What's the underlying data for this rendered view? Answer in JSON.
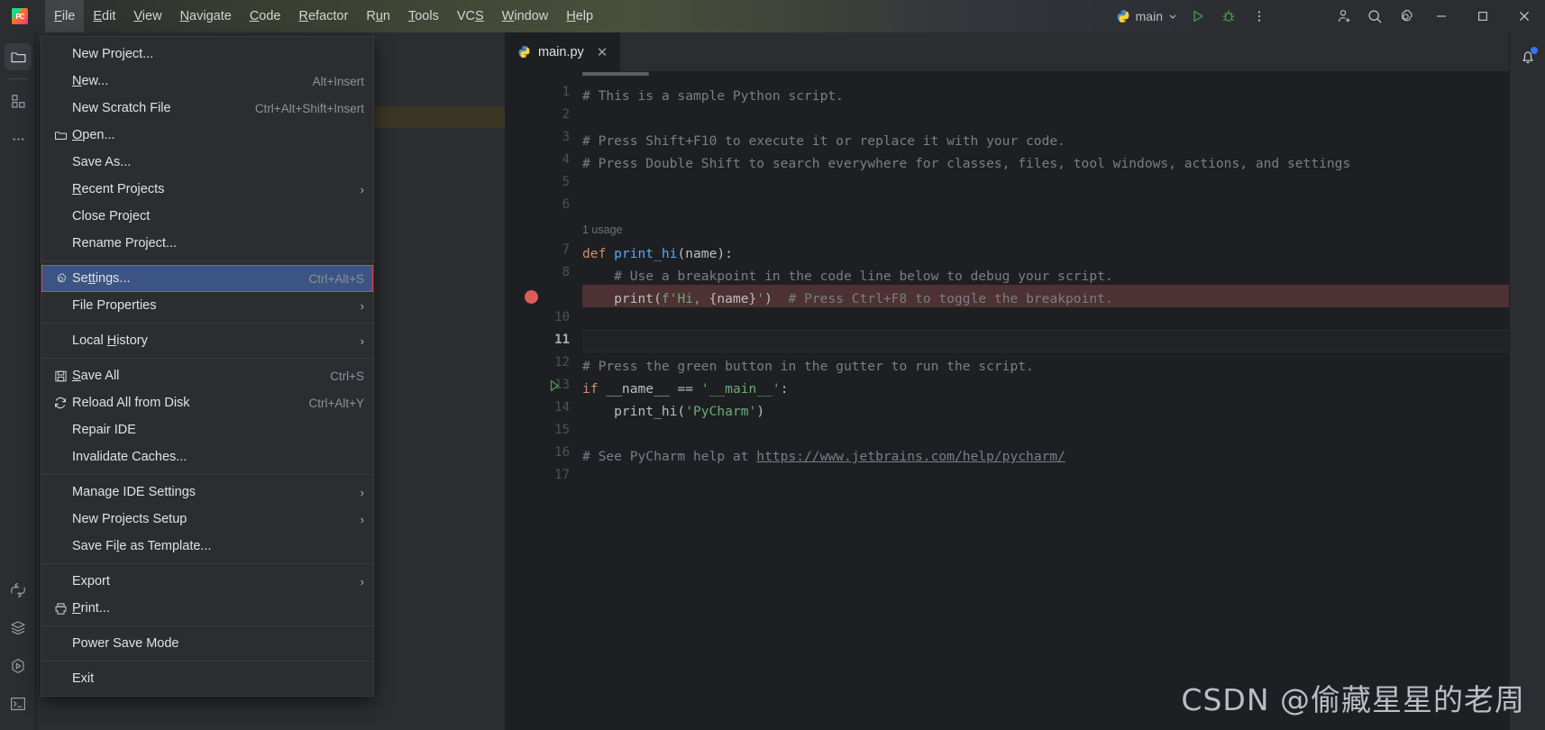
{
  "window": {
    "app_logo": "pycharm-logo",
    "menus": [
      {
        "label": "File",
        "mnemonic": "F",
        "open": true
      },
      {
        "label": "Edit",
        "mnemonic": "E",
        "open": false
      },
      {
        "label": "View",
        "mnemonic": "V",
        "open": false
      },
      {
        "label": "Navigate",
        "mnemonic": "N",
        "open": false
      },
      {
        "label": "Code",
        "mnemonic": "C",
        "open": false
      },
      {
        "label": "Refactor",
        "mnemonic": "R",
        "open": false
      },
      {
        "label": "Run",
        "mnemonic": "u",
        "open": false
      },
      {
        "label": "Tools",
        "mnemonic": "T",
        "open": false
      },
      {
        "label": "VCS",
        "mnemonic": "S",
        "open": false
      },
      {
        "label": "Window",
        "mnemonic": "W",
        "open": false
      },
      {
        "label": "Help",
        "mnemonic": "H",
        "open": false
      }
    ],
    "run_config": {
      "name": "main",
      "icon": "python-icon",
      "chevron": "chevron-down-icon"
    },
    "toolbar_icons": [
      "run-icon",
      "debug-icon",
      "more-vertical-icon"
    ],
    "right_icons": [
      "add-user-icon",
      "search-icon",
      "settings-gear-icon"
    ],
    "window_controls": {
      "minimize": "–",
      "maximize": "☐",
      "close": "✕"
    }
  },
  "file_menu": {
    "groups": [
      {
        "items": [
          {
            "label": "New Project...",
            "shortcut": "",
            "icon": "",
            "submenu": false,
            "selected": false
          },
          {
            "label": "New...",
            "mnemonic": "N",
            "shortcut": "Alt+Insert",
            "icon": "",
            "submenu": false,
            "selected": false
          },
          {
            "label": "New Scratch File",
            "shortcut": "Ctrl+Alt+Shift+Insert",
            "icon": "",
            "submenu": false,
            "selected": false
          },
          {
            "label": "Open...",
            "mnemonic": "O",
            "shortcut": "",
            "icon": "folder-icon",
            "submenu": false,
            "selected": false
          },
          {
            "label": "Save As...",
            "shortcut": "",
            "icon": "",
            "submenu": false,
            "selected": false
          },
          {
            "label": "Recent Projects",
            "mnemonic": "R",
            "shortcut": "",
            "icon": "",
            "submenu": true,
            "selected": false
          },
          {
            "label": "Close Project",
            "shortcut": "",
            "icon": "",
            "submenu": false,
            "selected": false
          },
          {
            "label": "Rename Project...",
            "shortcut": "",
            "icon": "",
            "submenu": false,
            "selected": false
          }
        ]
      },
      {
        "items": [
          {
            "label": "Settings...",
            "mnemonic": "tt",
            "shortcut": "Ctrl+Alt+S",
            "icon": "settings-gear-icon",
            "submenu": false,
            "selected": true
          },
          {
            "label": "File Properties",
            "shortcut": "",
            "icon": "",
            "submenu": true,
            "selected": false
          }
        ]
      },
      {
        "items": [
          {
            "label": "Local History",
            "mnemonic": "H",
            "shortcut": "",
            "icon": "",
            "submenu": true,
            "selected": false
          }
        ]
      },
      {
        "items": [
          {
            "label": "Save All",
            "mnemonic": "S",
            "shortcut": "Ctrl+S",
            "icon": "save-icon",
            "submenu": false,
            "selected": false
          },
          {
            "label": "Reload All from Disk",
            "shortcut": "Ctrl+Alt+Y",
            "icon": "reload-icon",
            "submenu": false,
            "selected": false
          },
          {
            "label": "Repair IDE",
            "shortcut": "",
            "icon": "",
            "submenu": false,
            "selected": false
          },
          {
            "label": "Invalidate Caches...",
            "shortcut": "",
            "icon": "",
            "submenu": false,
            "selected": false
          }
        ]
      },
      {
        "items": [
          {
            "label": "Manage IDE Settings",
            "shortcut": "",
            "icon": "",
            "submenu": true,
            "selected": false
          },
          {
            "label": "New Projects Setup",
            "shortcut": "",
            "icon": "",
            "submenu": true,
            "selected": false
          },
          {
            "label": "Save File as Template...",
            "mnemonic": "l",
            "shortcut": "",
            "icon": "",
            "submenu": false,
            "selected": false
          }
        ]
      },
      {
        "items": [
          {
            "label": "Export",
            "shortcut": "",
            "icon": "",
            "submenu": true,
            "selected": false
          },
          {
            "label": "Print...",
            "mnemonic": "P",
            "shortcut": "",
            "icon": "print-icon",
            "submenu": false,
            "selected": false
          }
        ]
      },
      {
        "items": [
          {
            "label": "Power Save Mode",
            "shortcut": "",
            "icon": "",
            "submenu": false,
            "selected": false
          }
        ]
      },
      {
        "items": [
          {
            "label": "Exit",
            "shortcut": "",
            "icon": "",
            "submenu": false,
            "selected": false
          }
        ]
      }
    ]
  },
  "left_toolbar": {
    "top_items": [
      {
        "name": "project-icon",
        "label": "Project",
        "active": true
      },
      {
        "name": "structure-icon",
        "label": "Structure",
        "active": false
      },
      {
        "name": "more-icon",
        "label": "More Tool Windows",
        "active": false
      }
    ],
    "bottom_items": [
      {
        "name": "python-console-icon",
        "label": "Python Console",
        "active": false
      },
      {
        "name": "database-icon",
        "label": "Database",
        "active": false
      },
      {
        "name": "run-icon",
        "label": "Run",
        "active": false
      },
      {
        "name": "terminal-icon",
        "label": "Terminal",
        "active": false
      }
    ]
  },
  "editor": {
    "tab": {
      "filename": "main.py",
      "icon": "python-icon",
      "close": "✕"
    },
    "tab_options_icon": "more-vertical-icon",
    "inspection_status": "check-icon",
    "inlay_hint": "1 usage",
    "breakpoint_line": 9,
    "current_line": 11,
    "run_gutter_line": 13,
    "lines": [
      {
        "n": 1,
        "text": "# This is a sample Python script."
      },
      {
        "n": 2,
        "text": ""
      },
      {
        "n": 3,
        "text": "# Press Shift+F10 to execute it or replace it with your code."
      },
      {
        "n": 4,
        "text": "# Press Double Shift to search everywhere for classes, files, tool windows, actions, and settings"
      },
      {
        "n": 5,
        "text": ""
      },
      {
        "n": 6,
        "text": ""
      },
      {
        "n": 7,
        "text": "def print_hi(name):"
      },
      {
        "n": 8,
        "text": "    # Use a breakpoint in the code line below to debug your script."
      },
      {
        "n": 9,
        "text": "    print(f'Hi, {name}')  # Press Ctrl+F8 to toggle the breakpoint."
      },
      {
        "n": 10,
        "text": ""
      },
      {
        "n": 11,
        "text": ""
      },
      {
        "n": 12,
        "text": "# Press the green button in the gutter to run the script."
      },
      {
        "n": 13,
        "text": "if __name__ == '__main__':"
      },
      {
        "n": 14,
        "text": "    print_hi('PyCharm')"
      },
      {
        "n": 15,
        "text": ""
      },
      {
        "n": 16,
        "text": "# See PyCharm help at https://www.jetbrains.com/help/pycharm/"
      },
      {
        "n": 17,
        "text": ""
      }
    ],
    "link_url": "https://www.jetbrains.com/help/pycharm/"
  },
  "right_toolbar": {
    "items": [
      {
        "name": "notifications-bell-icon",
        "label": "Notifications",
        "has_badge": true
      }
    ]
  },
  "watermark": {
    "text": "CSDN @偷藏星星的老周"
  },
  "colors": {
    "bg": "#1e1f22",
    "panel": "#2b2d30",
    "selection_blue": "#3b5483",
    "selection_border_red": "#f0394d",
    "breakpoint_red": "#db5c5c",
    "run_green": "#499c54",
    "accent_blue": "#3574f0",
    "comment_gray": "#7a7e85",
    "keyword_orange": "#cf8e6d",
    "string_green": "#6aab73",
    "function_blue": "#56a8f5"
  }
}
